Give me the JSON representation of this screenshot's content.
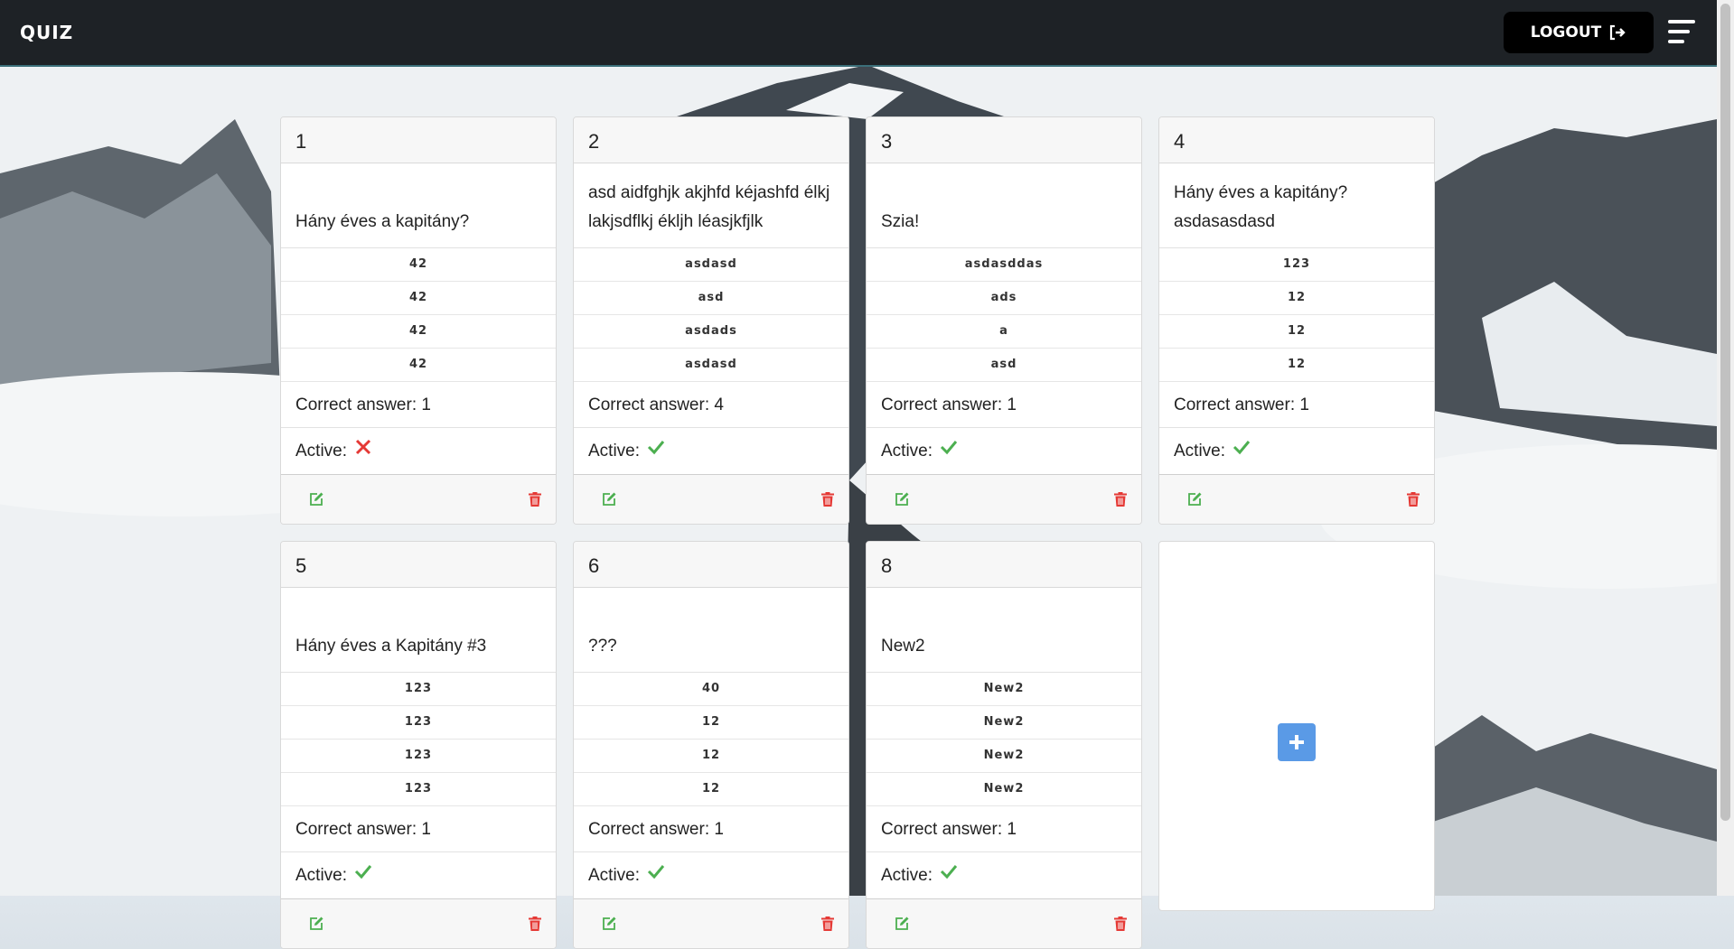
{
  "navbar": {
    "brand": "QUIZ",
    "logout_label": "LOGOUT"
  },
  "labels": {
    "correct_prefix": "Correct answer: ",
    "active_prefix": "Active:"
  },
  "colors": {
    "active_true": "#4caf50",
    "active_false": "#e53935",
    "edit": "#4caf50",
    "delete": "#e53935",
    "add": "#5a9ae6"
  },
  "cards": [
    {
      "id": "1",
      "question": "Hány éves a kapitány?",
      "answers": [
        "42",
        "42",
        "42",
        "42"
      ],
      "correct": "1",
      "active": false
    },
    {
      "id": "2",
      "question": "asd aidfghjk akjhfd kéjashfd élkj lakjsdflkj éklјh léasjkfjlk",
      "answers": [
        "asdasd",
        "asd",
        "asdads",
        "asdasd"
      ],
      "correct": "4",
      "active": true
    },
    {
      "id": "3",
      "question": "Szia!",
      "answers": [
        "asdasddas",
        "ads",
        "a",
        "asd"
      ],
      "correct": "1",
      "active": true
    },
    {
      "id": "4",
      "question": "Hány éves a kapitány? asdasasdasd",
      "answers": [
        "123",
        "12",
        "12",
        "12"
      ],
      "correct": "1",
      "active": true
    },
    {
      "id": "5",
      "question": "Hány éves a Kapitány #3",
      "answers": [
        "123",
        "123",
        "123",
        "123"
      ],
      "correct": "1",
      "active": true
    },
    {
      "id": "6",
      "question": "???",
      "answers": [
        "40",
        "12",
        "12",
        "12"
      ],
      "correct": "1",
      "active": true
    },
    {
      "id": "8",
      "question": "New2",
      "answers": [
        "New2",
        "New2",
        "New2",
        "New2"
      ],
      "correct": "1",
      "active": true
    }
  ],
  "icons": {
    "edit": "edit-icon",
    "delete": "trash-icon",
    "active_true": "check-icon",
    "active_false": "x-icon",
    "add": "plus-icon",
    "logout": "sign-out-icon",
    "menu": "hamburger-icon"
  }
}
